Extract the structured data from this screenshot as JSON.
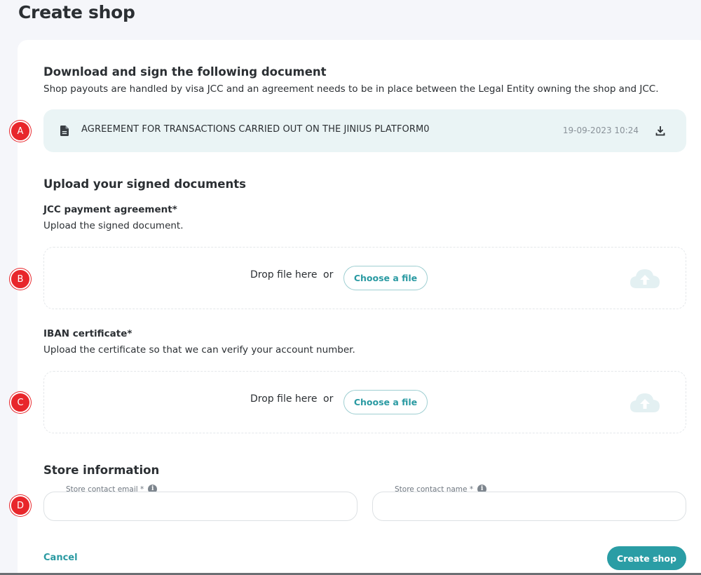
{
  "page": {
    "title": "Create shop"
  },
  "download_section": {
    "heading": "Download and sign the following document",
    "description": "Shop payouts are handled by visa JCC and an agreement needs to be in place between the Legal Entity owning the shop and JCC.",
    "document": {
      "name": "AGREEMENT FOR TRANSACTIONS CARRIED OUT ON THE JINIUS PLATFORM0",
      "date": "19-09-2023 10:24",
      "icon": "file-icon",
      "action_icon": "download-icon"
    }
  },
  "upload_section": {
    "heading": "Upload your signed documents",
    "jcc": {
      "title": "JCC payment agreement*",
      "description": "Upload the signed document.",
      "drop_text": "Drop file here",
      "or_text": "or",
      "button_label": "Choose a file"
    },
    "iban": {
      "title": "IBAN certificate*",
      "description": "Upload the certificate so that we can verify your account number.",
      "drop_text": "Drop file here",
      "or_text": "or",
      "button_label": "Choose a file"
    }
  },
  "store_section": {
    "heading": "Store information",
    "email_label": "Store contact email *",
    "name_label": "Store contact name *",
    "info_glyph": "i",
    "email_value": "",
    "name_value": ""
  },
  "actions": {
    "cancel_label": "Cancel",
    "create_label": "Create shop"
  },
  "annotations": [
    "A",
    "B",
    "C",
    "D"
  ],
  "colors": {
    "accent": "#2a9da5",
    "marker": "#e8262b",
    "doc_row_bg": "#eaf4f5",
    "page_bg": "#f5f6fa"
  }
}
